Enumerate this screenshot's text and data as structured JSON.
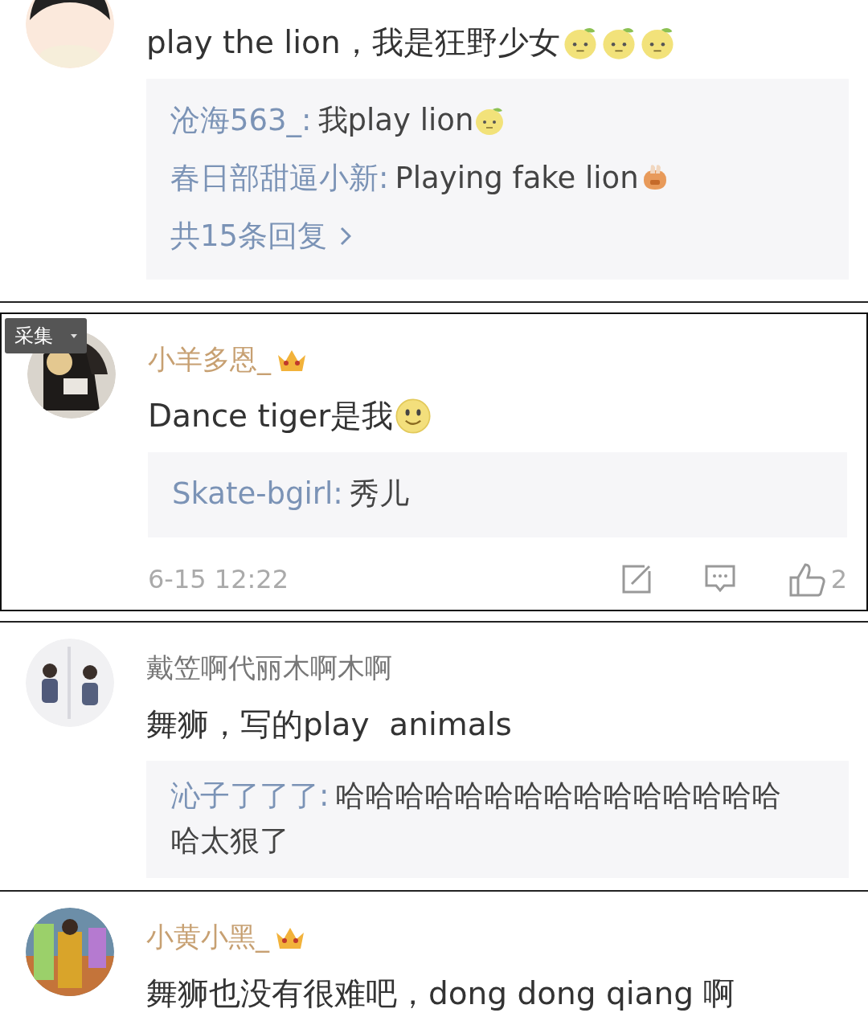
{
  "collect_button": {
    "label": "采集"
  },
  "comments": [
    {
      "framed": false,
      "avatar": {
        "kind": "cartoon"
      },
      "text": "play the lion，我是狂野少女",
      "emojis": [
        {
          "kind": "lemon"
        },
        {
          "kind": "lemon"
        },
        {
          "kind": "lemon"
        }
      ],
      "replies": [
        {
          "name": "沧海563_:",
          "text": "我play lion",
          "emojis": [
            {
              "kind": "lemon"
            }
          ]
        },
        {
          "name": "春日部甜逼小新:",
          "text": "Playing fake lion",
          "emojis": [
            {
              "kind": "hands"
            }
          ]
        }
      ],
      "more_replies": "共15条回复"
    },
    {
      "framed": true,
      "avatar": {
        "kind": "dark"
      },
      "name": "小羊多恩_",
      "vip": true,
      "text": "Dance tiger是我",
      "emojis": [
        {
          "kind": "smile"
        }
      ],
      "replies": [
        {
          "name": "Skate-bgirl:",
          "text": "秀儿"
        }
      ],
      "footer": {
        "time": "6-15 12:22",
        "likes": "2"
      }
    },
    {
      "framed": false,
      "avatar": {
        "kind": "light"
      },
      "name": "戴笠啊代丽木啊木啊",
      "vip": false,
      "text": "舞狮，写的play  animals",
      "replies": [
        {
          "name": "沁子了了了:",
          "text": "哈哈哈哈哈哈哈哈哈哈哈哈哈哈哈哈太狠了"
        }
      ]
    },
    {
      "framed": false,
      "avatar": {
        "kind": "colorful"
      },
      "name": "小黄小黑_",
      "vip": true,
      "text": "舞狮也没有很难吧，dong dong qiang 啊"
    }
  ]
}
